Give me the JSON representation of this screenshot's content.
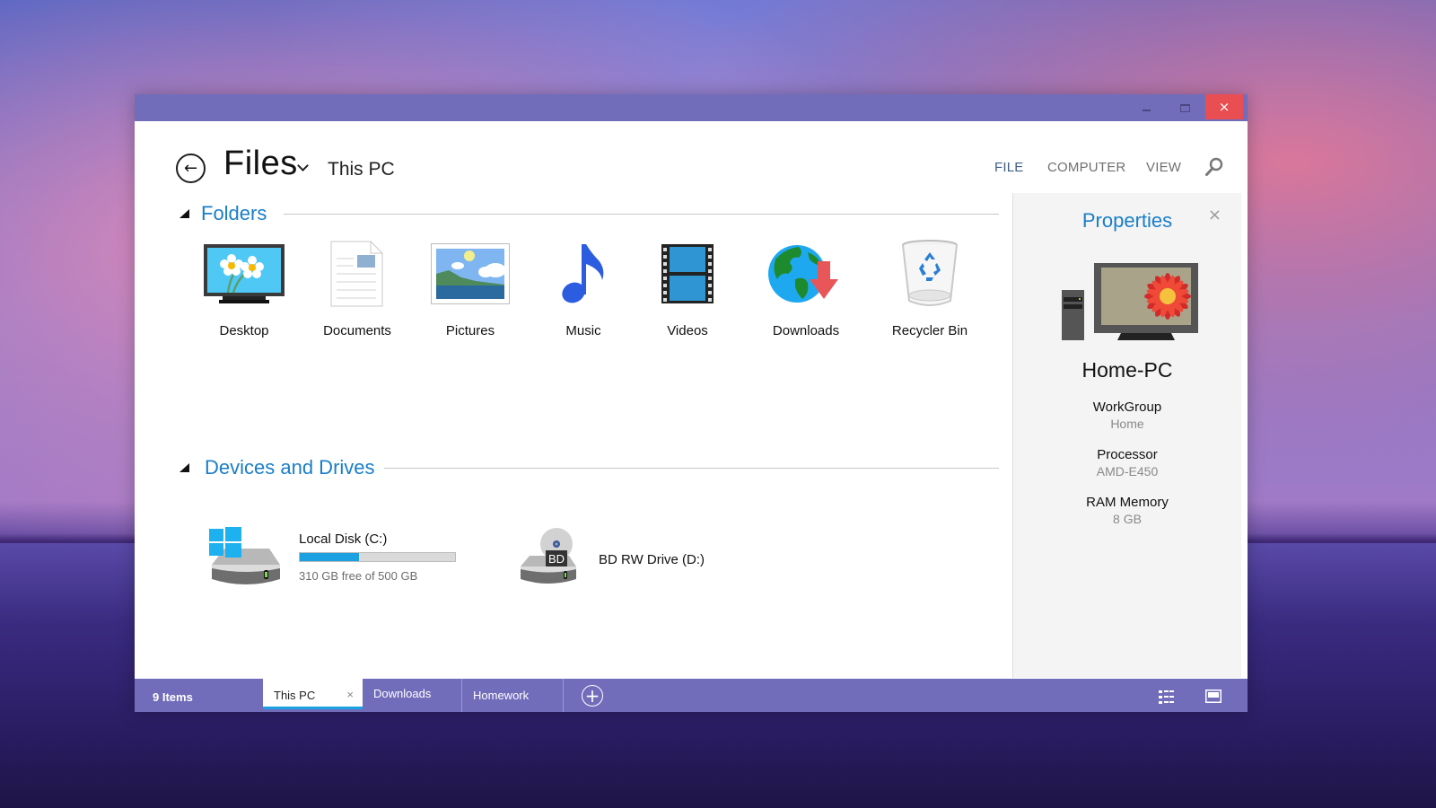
{
  "window": {
    "controls": {
      "minimize": "minimize",
      "maximize": "maximize",
      "close": "×"
    }
  },
  "header": {
    "back_icon": "←",
    "app_title": "Files",
    "location": "This PC",
    "menu": [
      {
        "label": "FILE",
        "active": true
      },
      {
        "label": "COMPUTER",
        "active": false
      },
      {
        "label": "VIEW",
        "active": false
      }
    ]
  },
  "sections": {
    "folders_title": "Folders",
    "drives_title": "Devices and Drives"
  },
  "folders": [
    {
      "label": "Desktop",
      "icon": "desktop-icon"
    },
    {
      "label": "Documents",
      "icon": "document-icon"
    },
    {
      "label": "Pictures",
      "icon": "picture-icon"
    },
    {
      "label": "Music",
      "icon": "music-note-icon"
    },
    {
      "label": "Videos",
      "icon": "film-strip-icon"
    },
    {
      "label": "Downloads",
      "icon": "globe-download-icon"
    },
    {
      "label": "Recycler Bin",
      "icon": "recycle-bin-icon"
    }
  ],
  "drives": [
    {
      "name": "Local Disk (C:)",
      "free_text": "310 GB free of 500 GB",
      "used_fraction": 0.38,
      "icon": "windows-hard-drive-icon"
    },
    {
      "name": "BD RW Drive (D:)",
      "badge": "BD",
      "icon": "bluray-drive-icon"
    }
  ],
  "properties": {
    "title": "Properties",
    "close": "×",
    "computer_name": "Home-PC",
    "items": [
      {
        "key": "WorkGroup",
        "value": "Home"
      },
      {
        "key": "Processor",
        "value": "AMD-E450"
      },
      {
        "key": "RAM Memory",
        "value": "8 GB"
      }
    ]
  },
  "bottombar": {
    "item_count": "9 Items",
    "tabs": [
      {
        "label": "This PC",
        "active": true,
        "close": "×"
      },
      {
        "label": "Downloads",
        "active": false
      },
      {
        "label": "Homework",
        "active": false
      }
    ],
    "add_tab": "+"
  },
  "colors": {
    "accent": "#716dbb",
    "link_blue": "#1a7ec8",
    "close_red": "#e94e52",
    "progress_blue": "#1ba1e2"
  }
}
